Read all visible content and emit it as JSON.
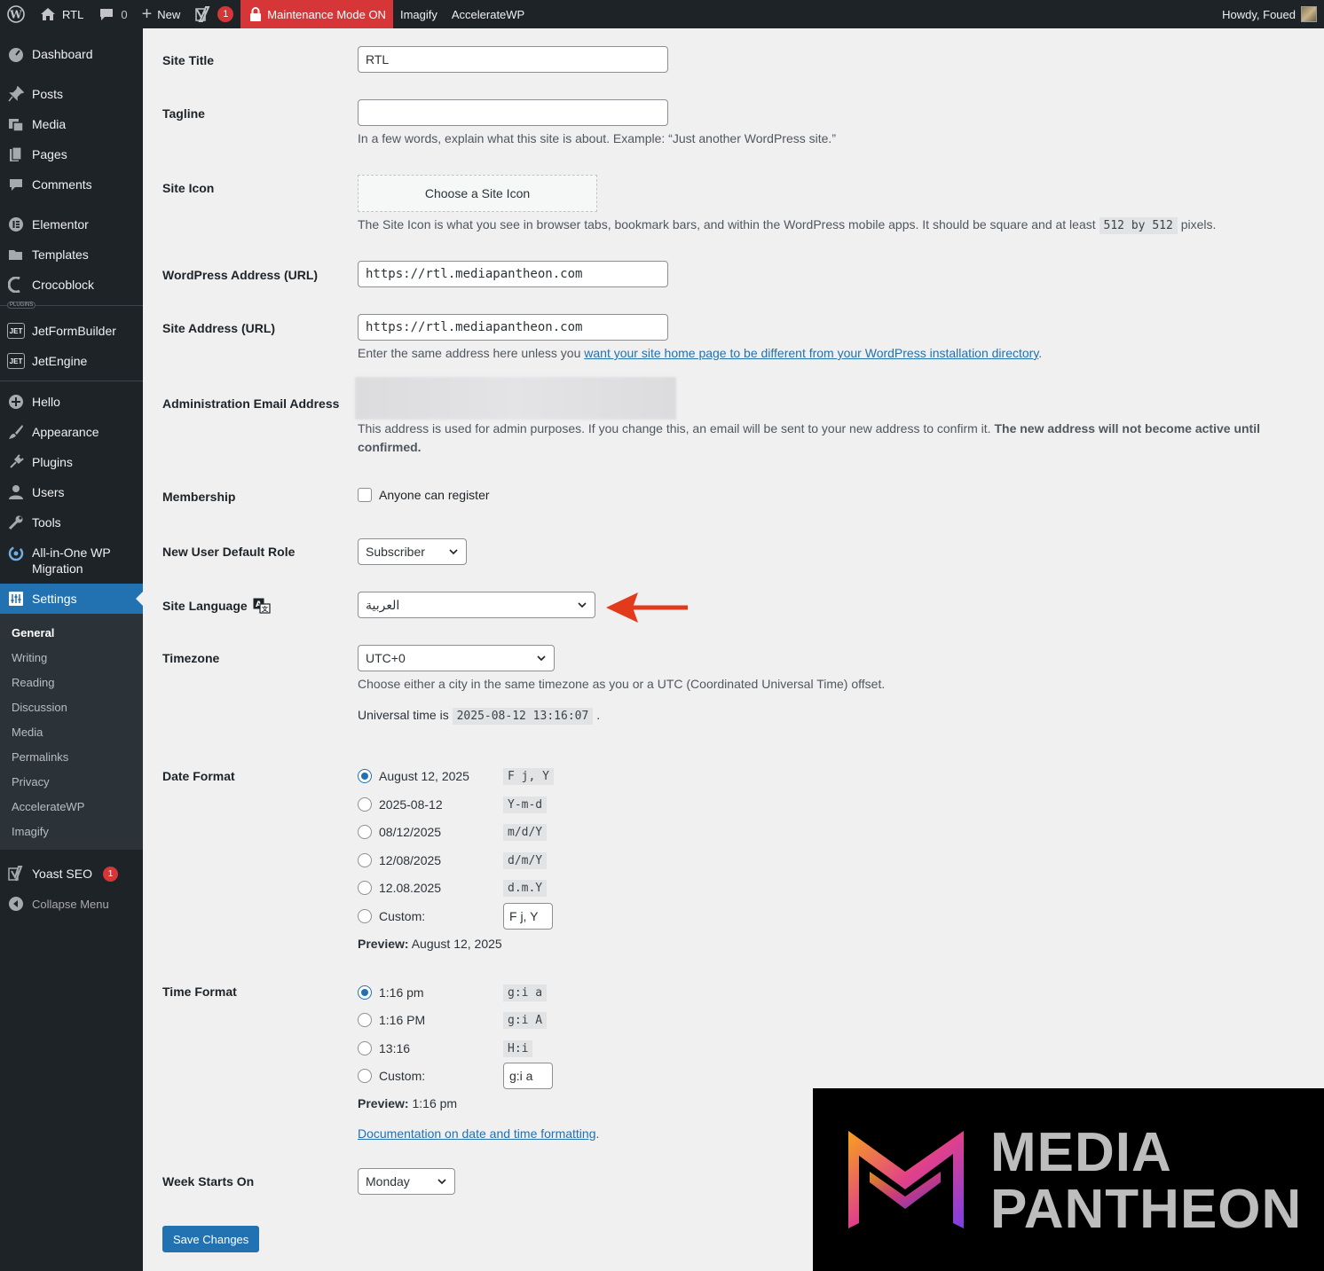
{
  "adminbar": {
    "site": "RTL",
    "comments_count": "0",
    "new_label": "New",
    "yoast_badge": "1",
    "maintenance": "Maintenance Mode ON",
    "imagify": "Imagify",
    "acceleratewp": "AccelerateWP",
    "howdy": "Howdy, Foued"
  },
  "sidebar": {
    "items": [
      {
        "label": "Dashboard",
        "icon": "dashboard-icon"
      },
      {
        "label": "Posts",
        "icon": "pin-icon"
      },
      {
        "label": "Media",
        "icon": "media-icon"
      },
      {
        "label": "Pages",
        "icon": "pages-icon"
      },
      {
        "label": "Comments",
        "icon": "comment-icon"
      },
      {
        "label": "Elementor",
        "icon": "elementor-icon"
      },
      {
        "label": "Templates",
        "icon": "folder-icon"
      },
      {
        "label": "Crocoblock",
        "icon": "crocoblock-icon"
      },
      {
        "label": "JetFormBuilder",
        "icon": "jet-icon"
      },
      {
        "label": "JetEngine",
        "icon": "jet-icon"
      },
      {
        "label": "Hello",
        "icon": "plus-circle-icon"
      },
      {
        "label": "Appearance",
        "icon": "brush-icon"
      },
      {
        "label": "Plugins",
        "icon": "plug-icon"
      },
      {
        "label": "Users",
        "icon": "user-icon"
      },
      {
        "label": "Tools",
        "icon": "wrench-icon"
      },
      {
        "label": "All-in-One WP Migration",
        "icon": "migration-icon"
      },
      {
        "label": "Settings",
        "icon": "settings-icon"
      }
    ],
    "plugins_tag": "PLUGINS",
    "jet_tag": "JET",
    "submenu": [
      "General",
      "Writing",
      "Reading",
      "Discussion",
      "Media",
      "Permalinks",
      "Privacy",
      "AccelerateWP",
      "Imagify"
    ],
    "yoast": "Yoast SEO",
    "yoast_badge": "1",
    "collapse": "Collapse Menu"
  },
  "form": {
    "site_title": {
      "label": "Site Title",
      "value": "RTL"
    },
    "tagline": {
      "label": "Tagline",
      "value": "",
      "desc": "In a few words, explain what this site is about. Example: “Just another WordPress site.”"
    },
    "site_icon": {
      "label": "Site Icon",
      "button": "Choose a Site Icon",
      "desc_pre": "The Site Icon is what you see in browser tabs, bookmark bars, and within the WordPress mobile apps. It should be square and at least",
      "size1": "512",
      "by": "by",
      "size2": "512",
      "desc_post": "pixels."
    },
    "wp_address": {
      "label": "WordPress Address (URL)",
      "value": "https://rtl.mediapantheon.com"
    },
    "site_address": {
      "label": "Site Address (URL)",
      "value": "https://rtl.mediapantheon.com",
      "desc_pre": "Enter the same address here unless you",
      "desc_link": "want your site home page to be different from your WordPress installation directory",
      "desc_post": "."
    },
    "admin_email": {
      "label": "Administration Email Address",
      "desc": "This address is used for admin purposes. If you change this, an email will be sent to your new address to confirm it.",
      "desc_bold_1": "The new address will not become active until",
      "desc_bold_2": "confirmed."
    },
    "membership": {
      "label": "Membership",
      "checkbox": "Anyone can register"
    },
    "default_role": {
      "label": "New User Default Role",
      "value": "Subscriber"
    },
    "site_language": {
      "label": "Site Language",
      "value": "العربية"
    },
    "timezone": {
      "label": "Timezone",
      "value": "UTC+0",
      "desc": "Choose either a city in the same timezone as you or a UTC (Coordinated Universal Time) offset.",
      "universal_label": "Universal time is",
      "universal_value": "2025-08-12 13:16:07",
      "universal_post": "."
    },
    "date_format": {
      "label": "Date Format",
      "options": [
        {
          "label": "August 12, 2025",
          "code": "F j, Y",
          "checked": true
        },
        {
          "label": "2025-08-12",
          "code": "Y-m-d",
          "checked": false
        },
        {
          "label": "08/12/2025",
          "code": "m/d/Y",
          "checked": false
        },
        {
          "label": "12/08/2025",
          "code": "d/m/Y",
          "checked": false
        },
        {
          "label": "12.08.2025",
          "code": "d.m.Y",
          "checked": false
        }
      ],
      "custom_label": "Custom:",
      "custom_value": "F j, Y",
      "preview_label": "Preview:",
      "preview_value": "August 12, 2025"
    },
    "time_format": {
      "label": "Time Format",
      "options": [
        {
          "label": "1:16 pm",
          "code": "g:i a",
          "checked": true
        },
        {
          "label": "1:16 PM",
          "code": "g:i A",
          "checked": false
        },
        {
          "label": "13:16",
          "code": "H:i",
          "checked": false
        }
      ],
      "custom_label": "Custom:",
      "custom_value": "g:i a",
      "preview_label": "Preview:",
      "preview_value": "1:16 pm",
      "doc_link": "Documentation on date and time formatting",
      "doc_post": "."
    },
    "week_starts": {
      "label": "Week Starts On",
      "value": "Monday"
    },
    "save": "Save Changes"
  },
  "watermark": {
    "line1": "MEDIA",
    "line2": "PANTHEON"
  },
  "colors": {
    "accent": "#2271b1",
    "admin_dark": "#1d2327",
    "alert": "#d63638",
    "arrow": "#e23b1b"
  }
}
